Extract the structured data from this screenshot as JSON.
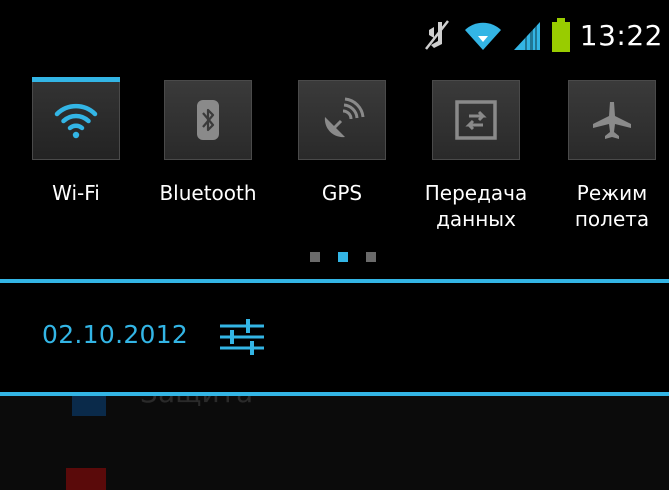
{
  "status_bar": {
    "time": "13:22",
    "icons": [
      "mute-icon",
      "wifi-icon",
      "signal-icon",
      "battery-icon"
    ],
    "accent_color": "#33b5e5"
  },
  "quick_settings": {
    "tiles": [
      {
        "label": "Wi-Fi",
        "icon": "wifi-icon",
        "active": true
      },
      {
        "label": "Bluetooth",
        "icon": "bluetooth-icon",
        "active": false
      },
      {
        "label": "GPS",
        "icon": "gps-icon",
        "active": false
      },
      {
        "label": "Передача\nданных",
        "icon": "data-transfer-icon",
        "active": false
      },
      {
        "label": "Режим\nполета",
        "icon": "airplane-icon",
        "active": false
      }
    ],
    "pages": 3,
    "current_page": 2
  },
  "date_row": {
    "date": "02.10.2012",
    "settings_icon": "settings-sliders-icon"
  },
  "background_items": [
    {
      "label": "Защита",
      "icon_color": "#0a2a4a"
    },
    {
      "label": "",
      "icon_color": "#5a0a0a"
    }
  ]
}
